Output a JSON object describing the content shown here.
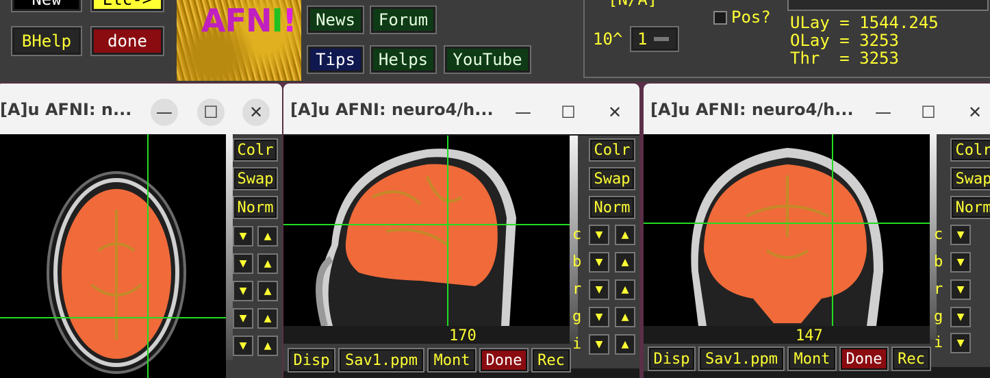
{
  "controller": {
    "btn_new": "New",
    "btn_etc": "Etc->",
    "btn_bhelp": "BHelp",
    "btn_done": "done",
    "logo_text": "AFNI!",
    "btn_news": "News",
    "btn_forum": "Forum",
    "btn_tips": "Tips",
    "btn_helps": "Helps",
    "btn_youtube": "YouTube",
    "range_label": "[N/A]",
    "exp_label": "10^",
    "exp_value": "1",
    "pos_label": "Pos?",
    "ulay_line": "ULay = 1544.245",
    "olay_line": "OLay = 3253",
    "thr_line": "Thr  = 3253"
  },
  "windows": [
    {
      "title": "[A]u AFNI: n...",
      "view": "axial",
      "side_buttons": [
        "Colr",
        "Swap",
        "Norm"
      ]
    },
    {
      "title": "[A]u AFNI: neuro4/h...",
      "view": "sagittal",
      "slice": "170",
      "side_buttons": [
        "Colr",
        "Swap",
        "Norm"
      ],
      "row_labels": [
        "c",
        "b",
        "r",
        "g",
        "i"
      ],
      "bottom_buttons": [
        "Disp",
        "Sav1.ppm",
        "Mont",
        "Done",
        "Rec"
      ]
    },
    {
      "title": "[A]u AFNI: neuro4/h...",
      "view": "coronal",
      "slice": "147",
      "side_buttons": [
        "Colr",
        "Swap",
        "Norm"
      ],
      "row_labels": [
        "c",
        "b",
        "r",
        "g",
        "i"
      ],
      "bottom_buttons": [
        "Disp",
        "Sav1.ppm",
        "Mont",
        "Done",
        "Rec"
      ]
    }
  ],
  "colors": {
    "label_yellow": "#ffff33",
    "overlay_orange": "#f06a3a",
    "crosshair_green": "#22dd22",
    "done_red": "#8a0b10"
  }
}
